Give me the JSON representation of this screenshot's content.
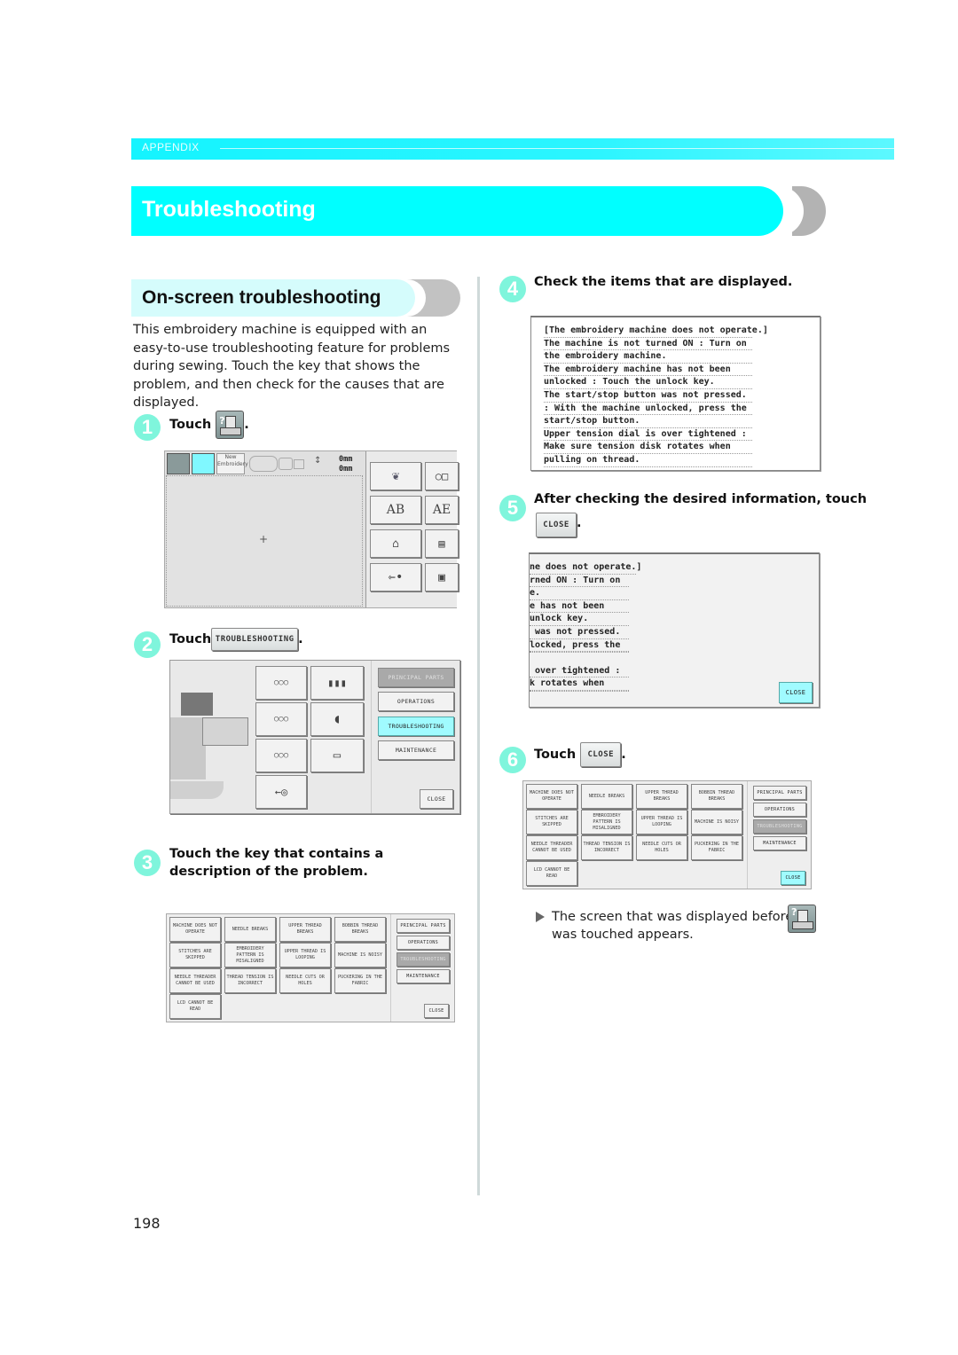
{
  "header": {
    "section_label": "APPENDIX",
    "title": "Troubleshooting"
  },
  "section": {
    "heading": "On-screen troubleshooting",
    "intro": "This embroidery machine is equipped with an easy-to-use troubleshooting feature for problems during sewing. Touch the key that shows the problem, and then check for the causes that are displayed."
  },
  "steps": [
    {
      "num": "1",
      "text": "Touch",
      "suffix": ".",
      "key_icon": "help-machine-icon"
    },
    {
      "num": "2",
      "text": "Touch",
      "suffix": ".",
      "key_label": "TROUBLESHOOTING"
    },
    {
      "num": "3",
      "text": "Touch the key that contains a description of the problem."
    },
    {
      "num": "4",
      "text": "Check the items that are displayed."
    },
    {
      "num": "5",
      "text": "After checking the desired information, touch",
      "suffix": ".",
      "key_label": "CLOSE"
    },
    {
      "num": "6",
      "text": "Touch",
      "suffix": ".",
      "key_label": "CLOSE"
    }
  ],
  "screen1": {
    "new_embroidery": "New Embroidery",
    "size_w": "0mm",
    "size_h": "0mm",
    "crosshair": "+"
  },
  "screen2": {
    "menu": [
      "PRINCIPAL PARTS",
      "OPERATIONS",
      "TROUBLESHOOTING",
      "MAINTENANCE"
    ],
    "close": "CLOSE",
    "active": "TROUBLESHOOTING"
  },
  "problems": {
    "keys": [
      "MACHINE DOES NOT OPERATE",
      "NEEDLE BREAKS",
      "UPPER THREAD BREAKS",
      "BOBBIN THREAD BREAKS",
      "STITCHES ARE SKIPPED",
      "EMBROIDERY PATTERN IS MISALIGNED",
      "UPPER THREAD IS LOOPING",
      "MACHINE IS NOISY",
      "NEEDLE THREADER CANNOT BE USED",
      "THREAD TENSION IS INCORRECT",
      "NEEDLE CUTS OR HOLES",
      "PUCKERING IN THE FABRIC",
      "LCD CANNOT BE READ"
    ],
    "menu": [
      "PRINCIPAL PARTS",
      "OPERATIONS",
      "TROUBLESHOOTING",
      "MAINTENANCE"
    ],
    "close": "CLOSE"
  },
  "message": {
    "lines": [
      "[The embroidery machine does not operate.]",
      "The machine is not turned ON : Turn on",
      "the embroidery machine.",
      "The embroidery machine has not been",
      "unlocked : Touch the unlock key.",
      "The start/stop button was not pressed.",
      ": With the machine unlocked, press the",
      "start/stop button.",
      "Upper tension dial is over tightened :",
      "Make sure tension disk rotates when",
      "pulling on thread."
    ],
    "cropped_lines": [
      "ne does not operate.]",
      "rned ON : Turn on",
      "e.",
      "e has not been",
      "unlock key.",
      " was not pressed.",
      "locked, press the",
      "",
      " over tightened :",
      "k rotates when",
      ""
    ],
    "close": "CLOSE"
  },
  "result": {
    "text_before": "The screen that was displayed before",
    "text_after": "was touched appears."
  },
  "page_number": "198",
  "colors": {
    "accent_cyan": "#00ffff",
    "step_badge": "#7ff5dc",
    "cap_gray": "#b3b3b3"
  }
}
